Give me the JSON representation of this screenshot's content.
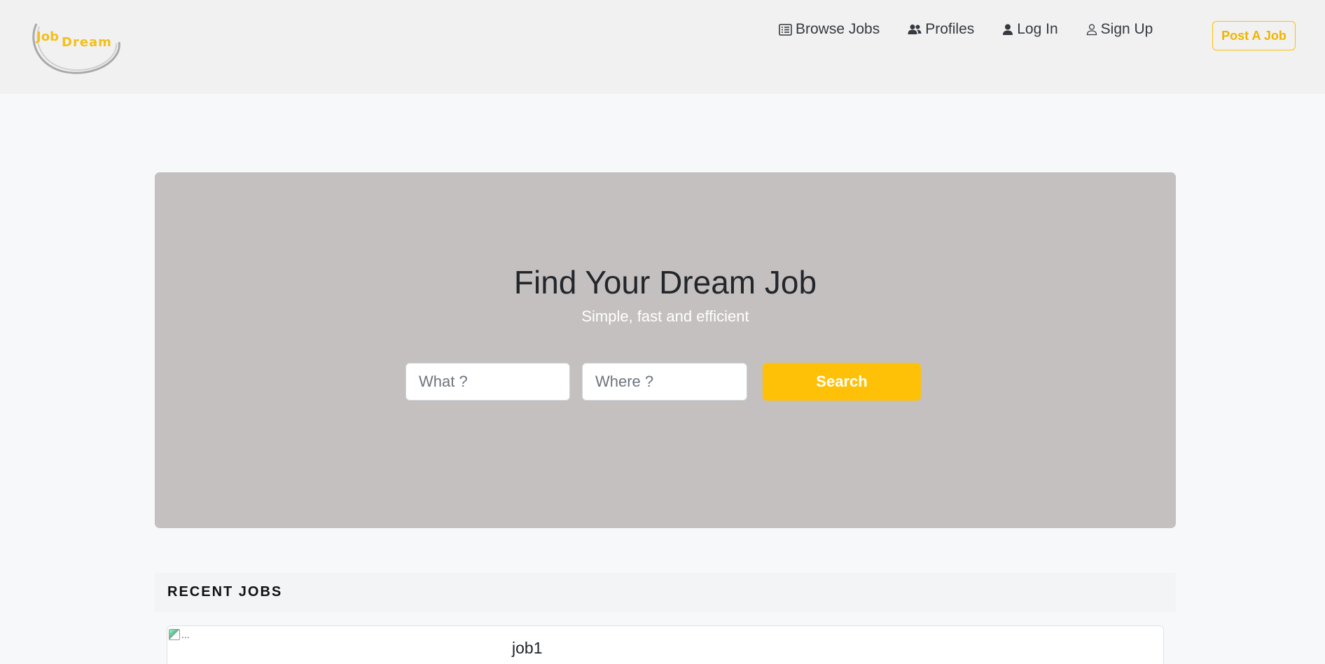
{
  "brand": {
    "logo_line1": "Job",
    "logo_line2": "Dream",
    "accent": "#ffc107"
  },
  "nav": {
    "items": [
      {
        "label": "Browse Jobs",
        "icon": "list-icon"
      },
      {
        "label": "Profiles",
        "icon": "users-icon"
      },
      {
        "label": "Log In",
        "icon": "user-solid-icon"
      },
      {
        "label": "Sign Up",
        "icon": "user-outline-icon"
      }
    ],
    "post_job_label": "Post A Job"
  },
  "hero": {
    "title": "Find Your Dream Job",
    "subtitle": "Simple, fast and efficient",
    "what_placeholder": "What ?",
    "where_placeholder": "Where ?",
    "search_label": "Search"
  },
  "recent": {
    "heading": "RECENT JOBS",
    "jobs": [
      {
        "title": "job1",
        "image_alt": "..."
      }
    ]
  }
}
